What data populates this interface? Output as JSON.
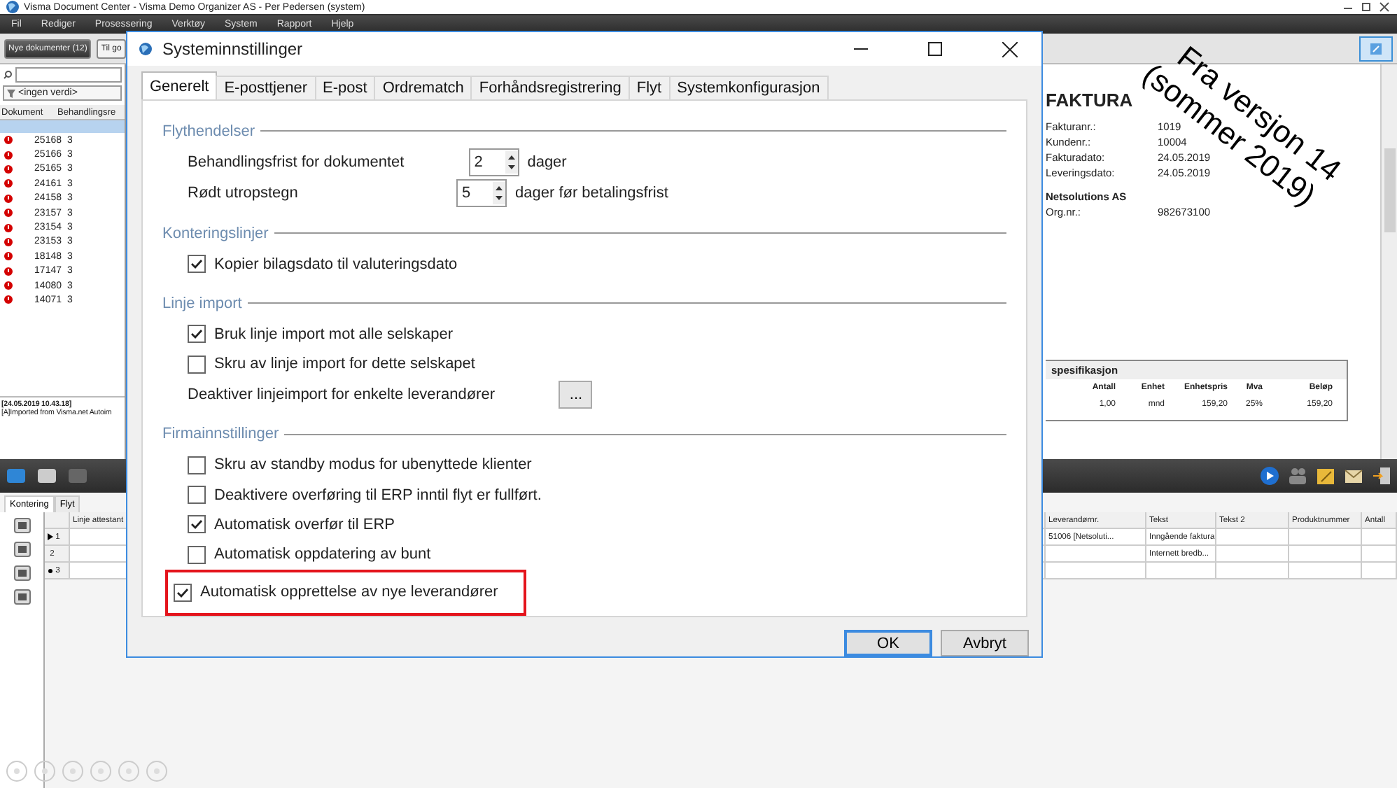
{
  "app": {
    "title": "Visma Document Center - Visma Demo Organizer AS - Per Pedersen (system)",
    "menu": [
      "Fil",
      "Rediger",
      "Prosessering",
      "Verktøy",
      "System",
      "Rapport",
      "Hjelp"
    ],
    "toolbar_buttons": [
      {
        "label": "Nye dokumenter (12)",
        "selected": true
      },
      {
        "label": "Til go",
        "selected": false
      }
    ]
  },
  "document_list": {
    "filter": "<ingen verdi>",
    "columns": [
      "Dokument",
      "Behandlingsre"
    ],
    "rows": [
      {
        "document": "25168",
        "column_2": "3"
      },
      {
        "document": "25166",
        "column_2": "3"
      },
      {
        "document": "25165",
        "column_2": "3"
      },
      {
        "document": "24161",
        "column_2": "3"
      },
      {
        "document": "24158",
        "column_2": "3"
      },
      {
        "document": "23157",
        "column_2": "3"
      },
      {
        "document": "23154",
        "column_2": "3"
      },
      {
        "document": "23153",
        "column_2": "3"
      },
      {
        "document": "18148",
        "column_2": "3"
      },
      {
        "document": "17147",
        "column_2": "3"
      },
      {
        "document": "14080",
        "column_2": "3"
      },
      {
        "document": "14071",
        "column_2": "3"
      }
    ]
  },
  "log": {
    "time": "[24.05.2019 10.43.18]",
    "message": "[A]Imported from Visma.net Autoim"
  },
  "invoice": {
    "title": "FAKTURA",
    "fields": [
      {
        "label": "Fakturanr.:",
        "value": "1019"
      },
      {
        "label": "Kundenr.:",
        "value": "10004"
      },
      {
        "label": "Fakturadato:",
        "value": "24.05.2019"
      },
      {
        "label": "Leveringsdato:",
        "value": "24.05.2019"
      }
    ],
    "company": "Netsolutions AS",
    "org": {
      "label": "Org.nr.:",
      "value": "982673100"
    },
    "specification": {
      "title": "spesifikasjon",
      "columns": [
        "Antall",
        "Enhet",
        "Enhetspris",
        "Mva",
        "Beløp"
      ],
      "rows": [
        [
          "1,00",
          "mnd",
          "159,20",
          "25%",
          "159,20"
        ]
      ]
    }
  },
  "lower_tabs": [
    {
      "label": "Kontering",
      "selected": true
    },
    {
      "label": "Flyt",
      "selected": false
    }
  ],
  "grid": {
    "columns": [
      "Linje attestant",
      "Leverandørnr.",
      "Tekst",
      "Tekst 2",
      "Produktnummer",
      "Antall"
    ],
    "rows": [
      {
        "number": "1",
        "current": true,
        "new": false,
        "supplier": "51006 [Netsoluti...",
        "text": "Inngående faktura"
      },
      {
        "number": "2",
        "current": false,
        "new": false,
        "text": "Internett bredb..."
      },
      {
        "number": "3",
        "current": false,
        "new": true
      }
    ]
  },
  "dialog": {
    "title": "Systeminnstillinger",
    "tabs": [
      {
        "label": "Generelt",
        "selected": true
      },
      {
        "label": "E-posttjener",
        "selected": false
      },
      {
        "label": "E-post",
        "selected": false
      },
      {
        "label": "Ordrematch",
        "selected": false
      },
      {
        "label": "Forhåndsregistrering",
        "selected": false
      },
      {
        "label": "Flyt",
        "selected": false
      },
      {
        "label": "Systemkonfigurasjon",
        "selected": false
      }
    ],
    "sections": [
      {
        "title": "Flythendelser",
        "items": [
          {
            "kind": "spinner",
            "label": "Behandlingsfrist for dokumentet",
            "value": "2",
            "unit": "dager"
          },
          {
            "kind": "spinner",
            "label": "Rødt utropstegn",
            "value": "5",
            "unit": "dager før betalingsfrist"
          }
        ]
      },
      {
        "title": "Konteringslinjer",
        "items": [
          {
            "kind": "checkbox",
            "label": "Kopier bilagsdato til valuteringsdato",
            "checked": true,
            "highlighted": false
          }
        ]
      },
      {
        "title": "Linje import",
        "items": [
          {
            "kind": "checkbox",
            "label": "Bruk linje import mot alle selskaper",
            "checked": true,
            "highlighted": false
          },
          {
            "kind": "checkbox",
            "label": "Skru av linje import for dette selskapet",
            "checked": false,
            "highlighted": false
          },
          {
            "kind": "button",
            "label": "Deaktiver linjeimport for enkelte leverandører",
            "button": "..."
          }
        ]
      },
      {
        "title": "Firmainnstillinger",
        "items": [
          {
            "kind": "checkbox",
            "label": "Skru av standby modus for ubenyttede klienter",
            "checked": false,
            "highlighted": false
          },
          {
            "kind": "checkbox",
            "label": "Deaktivere overføring til ERP inntil flyt er fullført.",
            "checked": false,
            "highlighted": false
          },
          {
            "kind": "checkbox",
            "label": "Automatisk overfør til ERP",
            "checked": true,
            "highlighted": false
          },
          {
            "kind": "checkbox",
            "label": "Automatisk oppdatering av bunt",
            "checked": false,
            "highlighted": false
          },
          {
            "kind": "checkbox",
            "label": "Automatisk opprettelse av nye leverandører",
            "checked": true,
            "highlighted": true
          }
        ]
      }
    ],
    "buttons": [
      "OK",
      "Avbryt"
    ]
  },
  "annotation": [
    "Fra versjon 14",
    "(sommer 2019)"
  ]
}
